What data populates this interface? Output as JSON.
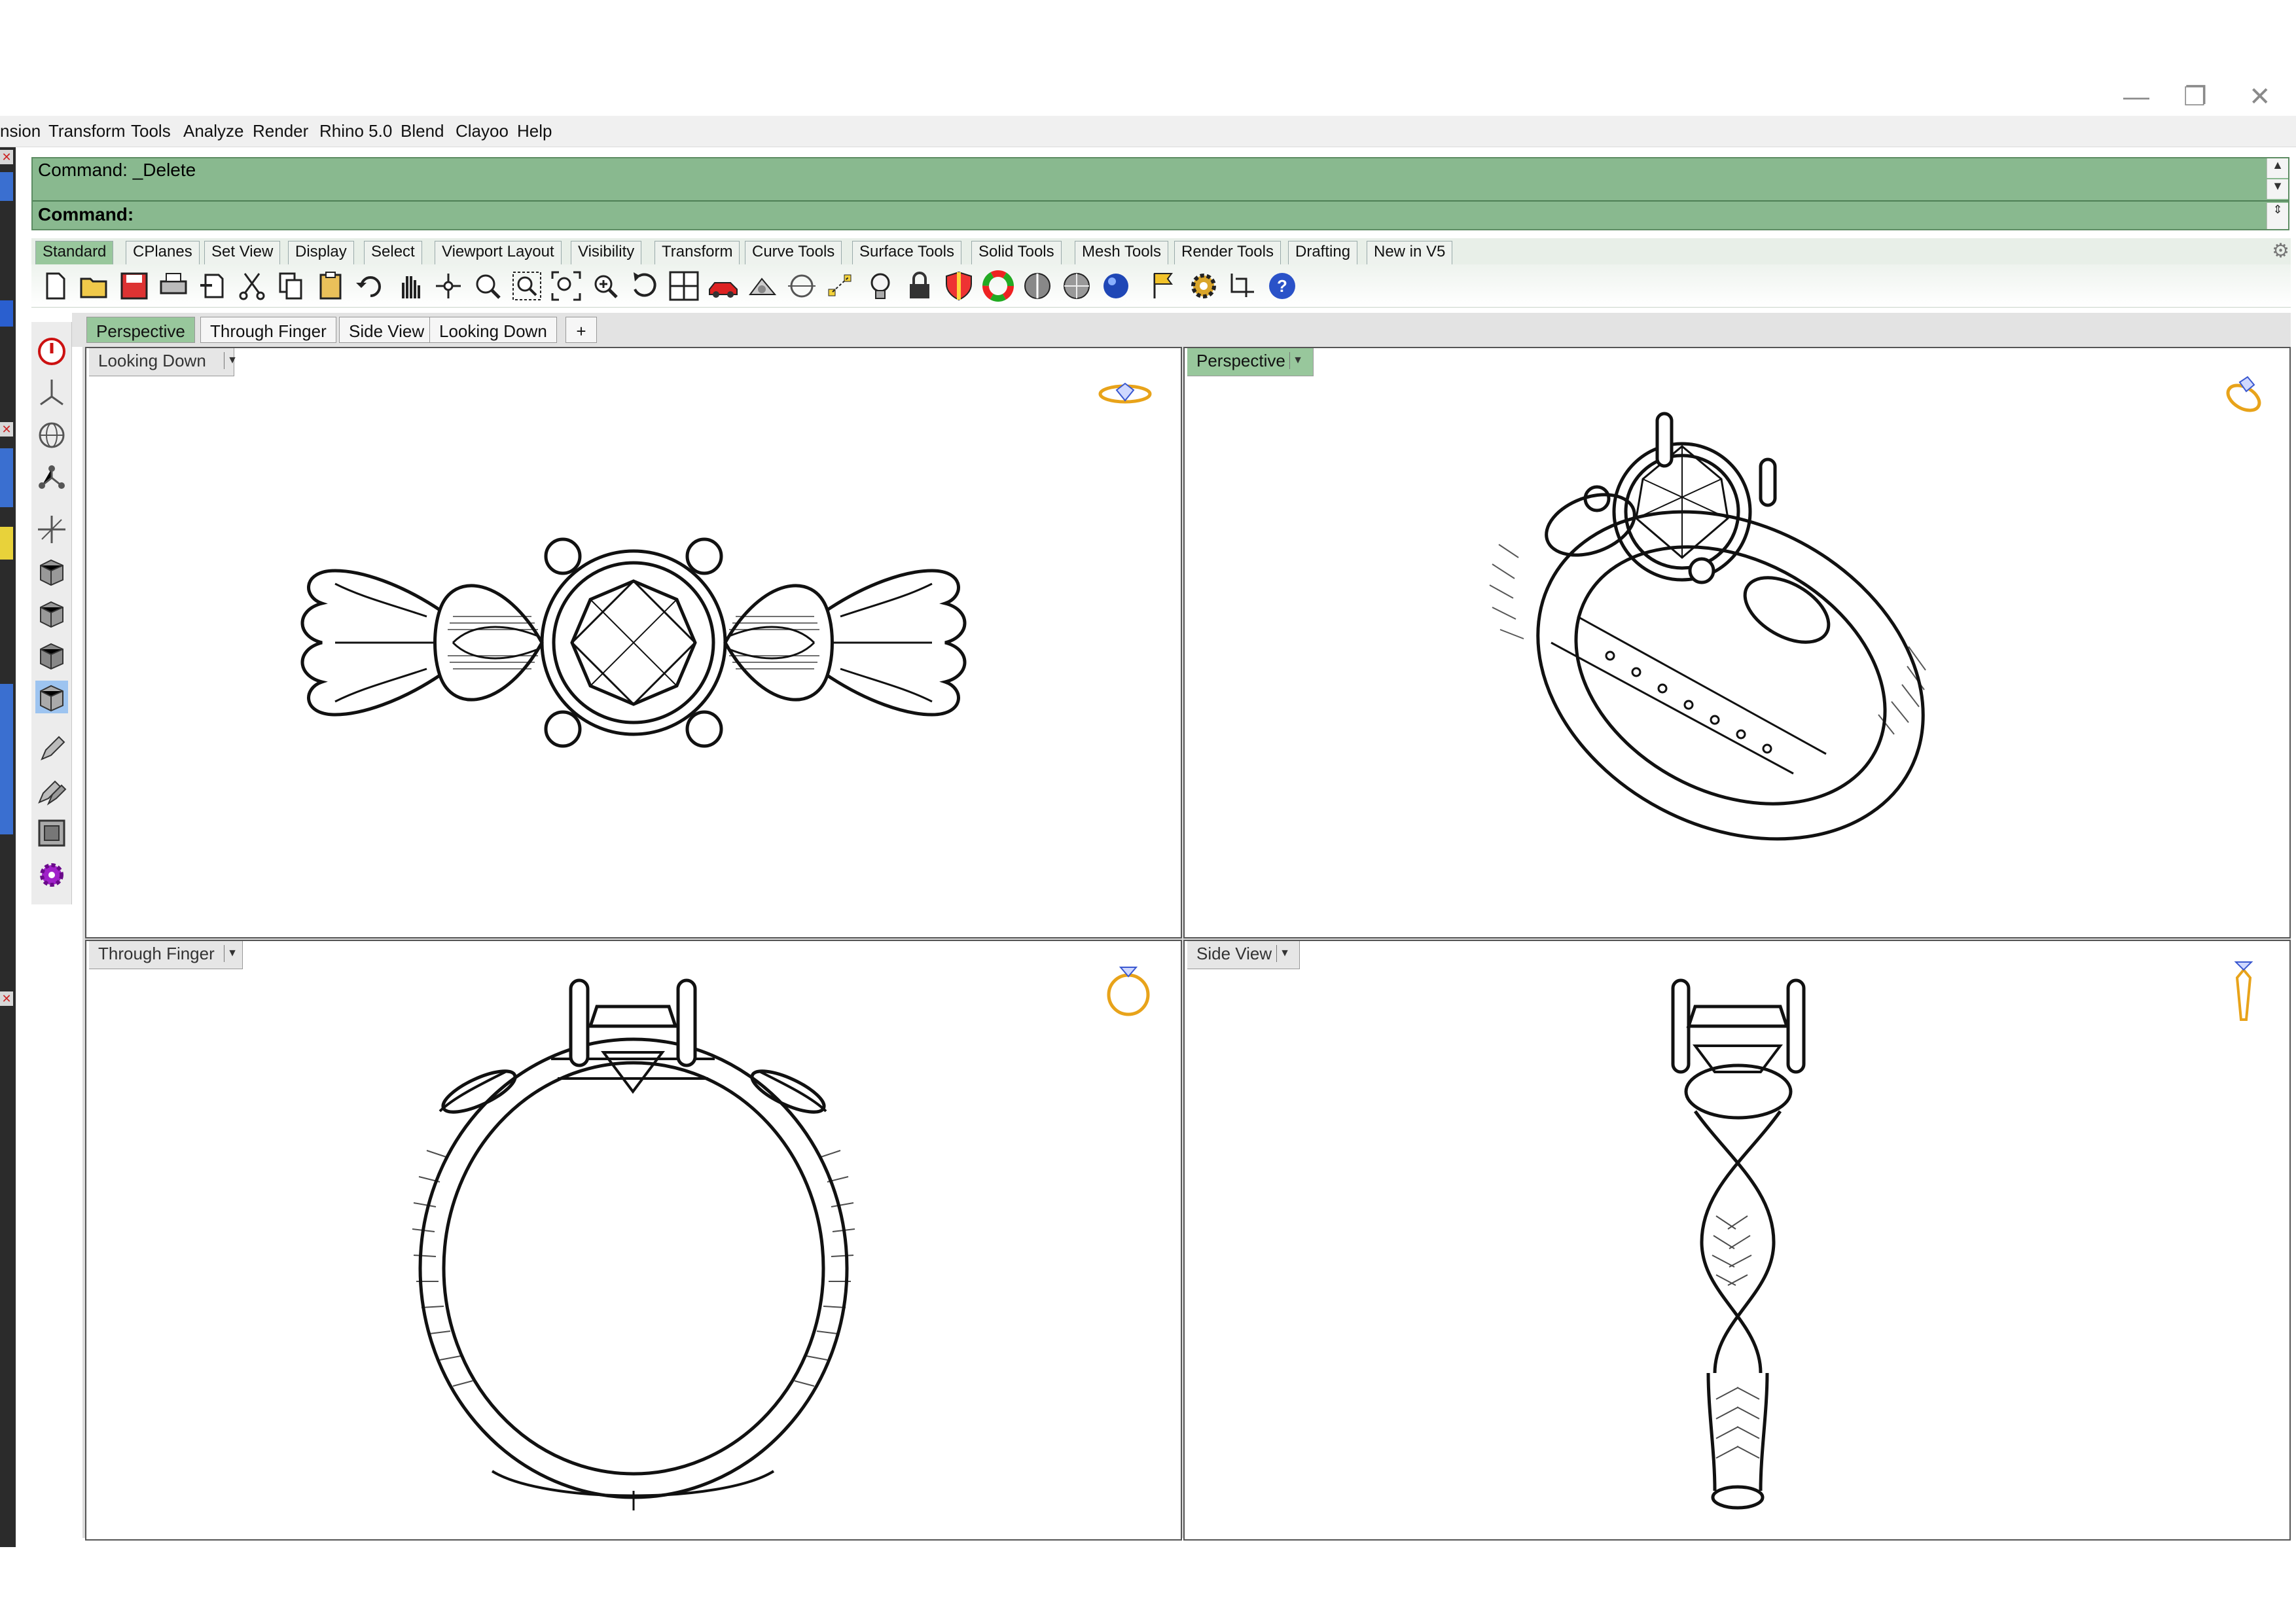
{
  "window": {
    "minimize": "—",
    "restore": "❐",
    "close": "✕"
  },
  "menu": [
    "nsion",
    "Transform",
    "Tools",
    "Analyze",
    "Render",
    "Rhino 5.0",
    "Blend",
    "Clayoo",
    "Help"
  ],
  "command": {
    "history": "Command: _Delete",
    "prompt": "Command:"
  },
  "toolbar_tabs": [
    "Standard",
    "CPlanes",
    "Set View",
    "Display",
    "Select",
    "Viewport Layout",
    "Visibility",
    "Transform",
    "Curve Tools",
    "Surface Tools",
    "Solid Tools",
    "Mesh Tools",
    "Render Tools",
    "Drafting",
    "New in V5"
  ],
  "toolbar_icons": [
    "new-icon",
    "open-icon",
    "save-icon",
    "print-icon",
    "import-icon",
    "cut-icon",
    "copy-icon",
    "paste-icon",
    "undo-icon",
    "pan-icon",
    "rotate-view-icon",
    "zoom-icon",
    "zoom-window-icon",
    "zoom-extents-icon",
    "zoom-selected-icon",
    "rotate-icon",
    "four-viewports-icon",
    "car-icon",
    "object-properties-icon",
    "curve-icon",
    "points-icon",
    "light-icon",
    "lock-icon",
    "shield-icon",
    "color-wheel-icon",
    "shaded-sphere-icon",
    "rendered-sphere-icon",
    "render-sphere-icon",
    "flag-icon",
    "gear-options-icon",
    "dimension-icon",
    "help-icon"
  ],
  "left_tools": [
    "stop-icon",
    "pivot-icon",
    "globe-icon",
    "network-icon",
    "axes-icon",
    "box-front-icon",
    "box-back-icon",
    "box-left-icon",
    "box-active-icon",
    "pencil-icon",
    "multi-pencil-icon",
    "frame-icon",
    "gear-purple-icon"
  ],
  "viewport_tabs": [
    "Perspective",
    "Through Finger",
    "Side View",
    "Looking Down",
    "+"
  ],
  "viewports": {
    "top_left": "Looking Down",
    "top_right": "Perspective",
    "bottom_left": "Through Finger",
    "bottom_right": "Side View"
  },
  "colors": {
    "command_bg": "#89b98f",
    "active_tab": "#98c79c",
    "nav_gold": "#e8a31a",
    "nav_blue": "#3a58d0"
  }
}
